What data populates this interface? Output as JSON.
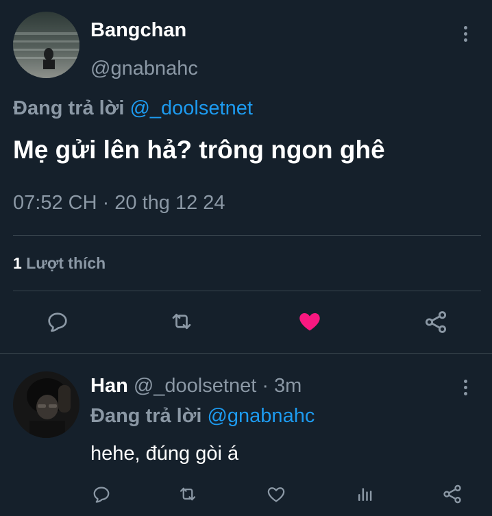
{
  "main_tweet": {
    "display_name": "Bangchan",
    "handle": "@gnabnahc",
    "replying_prefix": "Đang trả lời",
    "replying_to": "@_doolsetnet",
    "text": "Mẹ gửi lên hả? trông ngon ghê",
    "timestamp": "07:52 CH · 20 thg 12 24",
    "like_count": "1",
    "like_label": "Lượt thích",
    "liked": true,
    "like_color": "#f91880"
  },
  "reply": {
    "display_name": "Han",
    "handle": "@_doolsetnet",
    "time": "· 3m",
    "replying_prefix": "Đang trả lời",
    "replying_to": "@gnabnahc",
    "text": "hehe, đúng gòi á"
  },
  "colors": {
    "background": "#15202b",
    "muted": "#8b98a5",
    "link": "#1d9bf0",
    "divider": "#38444d"
  }
}
